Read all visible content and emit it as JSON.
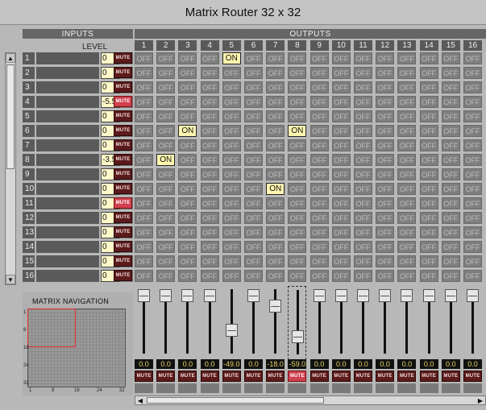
{
  "title": "Matrix Router 32 x 32",
  "inputs_header": "INPUTS",
  "outputs_header": "OUTPUTS",
  "level_header": "LEVEL",
  "mute_label": "MUTE",
  "on_label": "ON",
  "off_label": "OFF",
  "output_numbers": [
    "1",
    "2",
    "3",
    "4",
    "5",
    "6",
    "7",
    "8",
    "9",
    "10",
    "11",
    "12",
    "13",
    "14",
    "15",
    "16"
  ],
  "inputs": [
    {
      "num": "1",
      "level": "0",
      "mute_active": false
    },
    {
      "num": "2",
      "level": "0",
      "mute_active": false
    },
    {
      "num": "3",
      "level": "0",
      "mute_active": false
    },
    {
      "num": "4",
      "level": "-5.5",
      "mute_active": true
    },
    {
      "num": "5",
      "level": "0",
      "mute_active": false
    },
    {
      "num": "6",
      "level": "0",
      "mute_active": false
    },
    {
      "num": "7",
      "level": "0",
      "mute_active": false
    },
    {
      "num": "8",
      "level": "-3.5",
      "mute_active": false
    },
    {
      "num": "9",
      "level": "0",
      "mute_active": false
    },
    {
      "num": "10",
      "level": "0",
      "mute_active": false
    },
    {
      "num": "11",
      "level": "0",
      "mute_active": true
    },
    {
      "num": "12",
      "level": "0",
      "mute_active": false
    },
    {
      "num": "13",
      "level": "0",
      "mute_active": false
    },
    {
      "num": "14",
      "level": "0",
      "mute_active": false
    },
    {
      "num": "15",
      "level": "0",
      "mute_active": false
    },
    {
      "num": "16",
      "level": "0",
      "mute_active": false
    }
  ],
  "matrix_on": [
    {
      "input": 1,
      "output": 5
    },
    {
      "input": 6,
      "output": 3
    },
    {
      "input": 6,
      "output": 8
    },
    {
      "input": 8,
      "output": 2
    },
    {
      "input": 10,
      "output": 7
    }
  ],
  "navigation": {
    "label": "MATRIX NAVIGATION",
    "x_ticks": [
      "1",
      "8",
      "16",
      "24",
      "32"
    ],
    "y_ticks": [
      "1",
      "8",
      "16",
      "24",
      "32"
    ]
  },
  "outputs": [
    {
      "value": "0.0",
      "fader_level_fraction": 1.0,
      "mute_active": false,
      "selected": false
    },
    {
      "value": "0.0",
      "fader_level_fraction": 1.0,
      "mute_active": false,
      "selected": false
    },
    {
      "value": "0.0",
      "fader_level_fraction": 1.0,
      "mute_active": false,
      "selected": false
    },
    {
      "value": "0.0",
      "fader_level_fraction": 1.0,
      "mute_active": false,
      "selected": false
    },
    {
      "value": "-49.0",
      "fader_level_fraction": 0.35,
      "mute_active": false,
      "selected": false
    },
    {
      "value": "0.0",
      "fader_level_fraction": 1.0,
      "mute_active": false,
      "selected": false
    },
    {
      "value": "-18.0",
      "fader_level_fraction": 0.8,
      "mute_active": false,
      "selected": false
    },
    {
      "value": "-59.0",
      "fader_level_fraction": 0.25,
      "mute_active": true,
      "selected": true
    },
    {
      "value": "0.0",
      "fader_level_fraction": 1.0,
      "mute_active": false,
      "selected": false
    },
    {
      "value": "0.0",
      "fader_level_fraction": 1.0,
      "mute_active": false,
      "selected": false
    },
    {
      "value": "0.0",
      "fader_level_fraction": 1.0,
      "mute_active": false,
      "selected": false
    },
    {
      "value": "0.0",
      "fader_level_fraction": 1.0,
      "mute_active": false,
      "selected": false
    },
    {
      "value": "0.0",
      "fader_level_fraction": 1.0,
      "mute_active": false,
      "selected": false
    },
    {
      "value": "0.0",
      "fader_level_fraction": 1.0,
      "mute_active": false,
      "selected": false
    },
    {
      "value": "0.0",
      "fader_level_fraction": 1.0,
      "mute_active": false,
      "selected": false
    },
    {
      "value": "0.0",
      "fader_level_fraction": 1.0,
      "mute_active": false,
      "selected": false
    }
  ]
}
